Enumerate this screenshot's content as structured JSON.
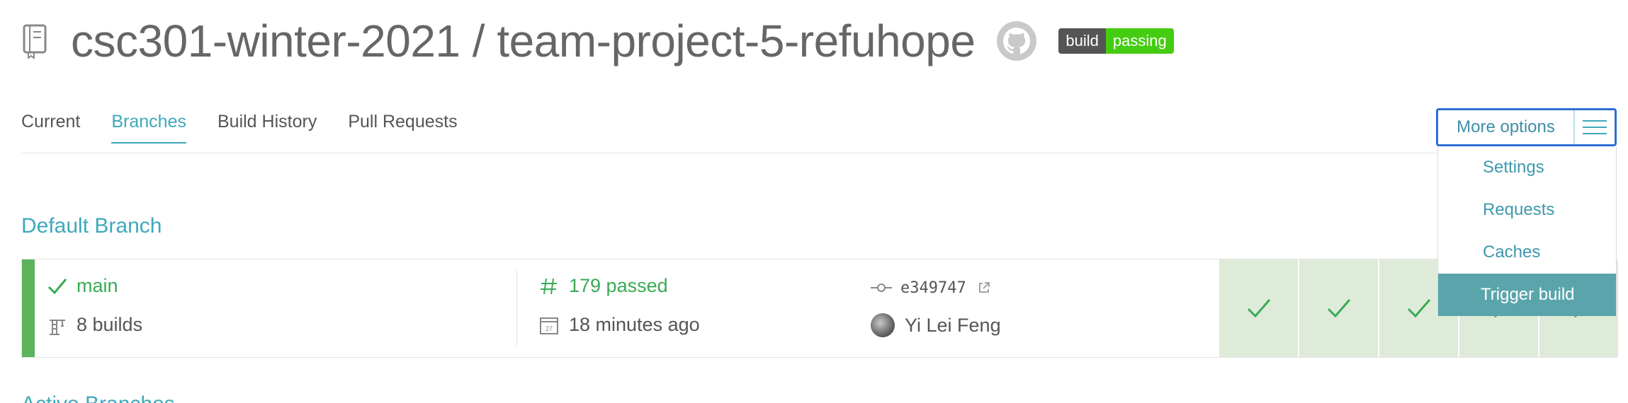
{
  "header": {
    "repo_title": "csc301-winter-2021 / team-project-5-refuhope",
    "badge_left": "build",
    "badge_right": "passing"
  },
  "tabs": [
    {
      "label": "Current",
      "active": false
    },
    {
      "label": "Branches",
      "active": true
    },
    {
      "label": "Build History",
      "active": false
    },
    {
      "label": "Pull Requests",
      "active": false
    }
  ],
  "more_options": {
    "label": "More options",
    "menu_items": [
      "Settings",
      "Requests",
      "Caches",
      "Trigger build"
    ],
    "highlighted": "Trigger build"
  },
  "default_branch": {
    "section_title": "Default Branch",
    "branch_name": "main",
    "builds": "8 builds",
    "build_status": "179 passed",
    "time_ago": "18 minutes ago",
    "commit": "e349747",
    "author": "Yi Lei Feng",
    "recent_builds": [
      "passed",
      "passed",
      "passed",
      "passed",
      "passed"
    ]
  },
  "next_section_title": "Active Branches",
  "colors": {
    "accent": "#3ea9bb",
    "passed": "#39aa56",
    "status_bar": "#5bb35b",
    "cell_bg": "#deebd8",
    "focus_border": "#2c6fd6",
    "menu_highlight": "#5aa5ac"
  },
  "icons": [
    "repo-icon",
    "github-icon",
    "check-icon",
    "crane-icon",
    "hash-icon",
    "calendar-icon",
    "commit-icon",
    "external-link-icon",
    "hamburger-icon"
  ]
}
